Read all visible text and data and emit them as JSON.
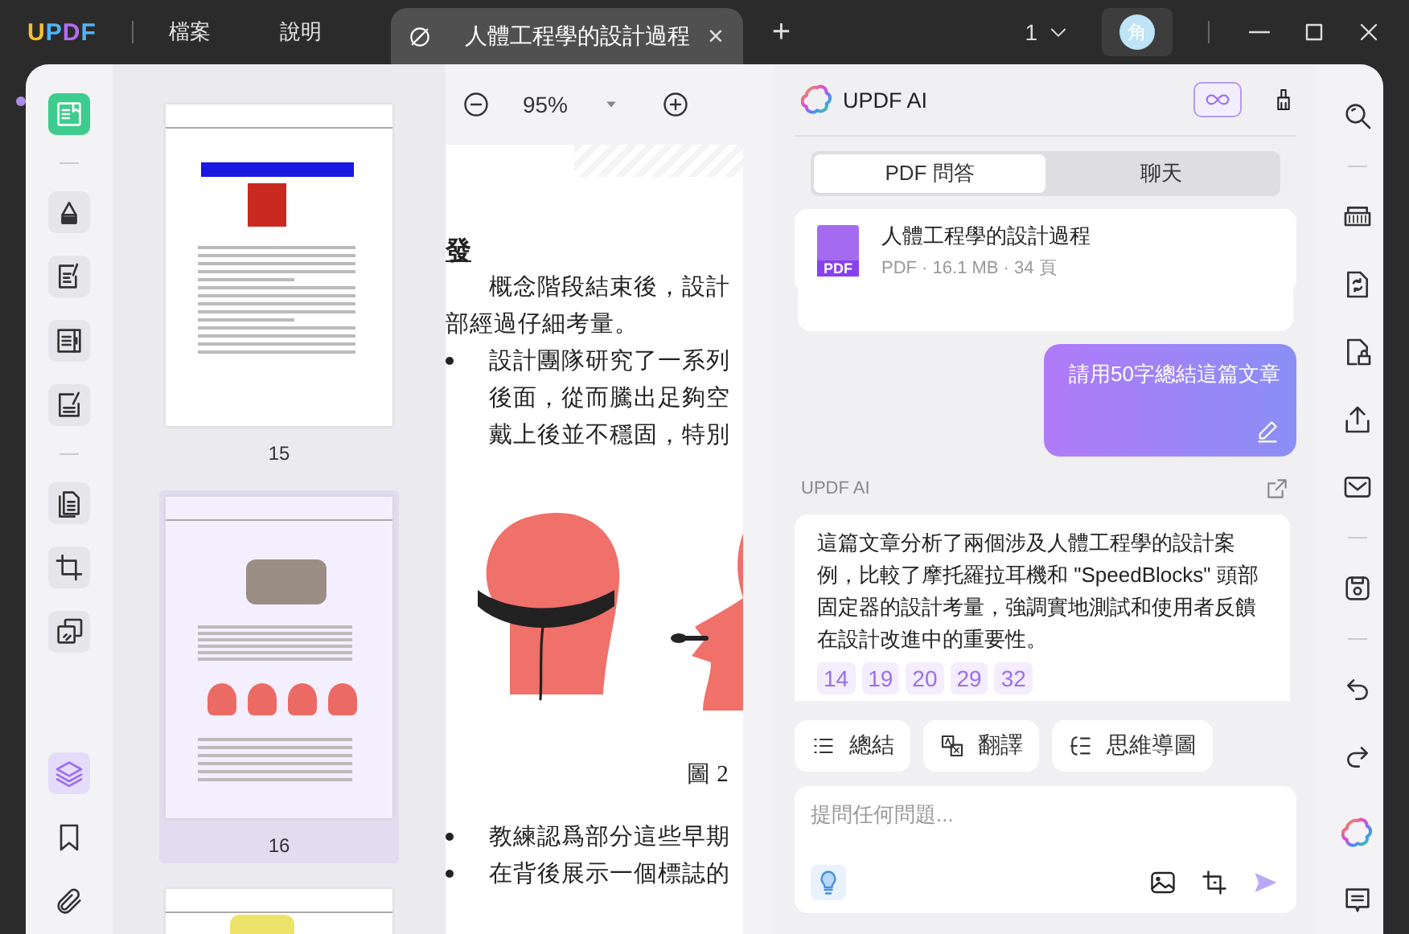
{
  "app_bar": {
    "logo": "UPDF",
    "menus": [
      "檔案",
      "說明"
    ],
    "document_tab": {
      "title": "人體工程學的設計過程",
      "close": "×",
      "selected": true
    },
    "new_tab": "+",
    "page_indicator": "1",
    "avatar": "角"
  },
  "left_rail": {
    "tools": [
      {
        "kind": "reader",
        "selected": true
      },
      {
        "kind": "separator"
      },
      {
        "kind": "highlighter",
        "selected": false
      },
      {
        "kind": "edit",
        "selected": false
      },
      {
        "kind": "columns",
        "selected": false
      },
      {
        "kind": "sign",
        "selected": false
      },
      {
        "kind": "separator"
      },
      {
        "kind": "pages",
        "selected": false
      },
      {
        "kind": "crop",
        "selected": false
      },
      {
        "kind": "stack",
        "selected": false
      },
      {
        "kind": "layers",
        "selected": true
      },
      {
        "kind": "bookmark",
        "selected": false
      },
      {
        "kind": "attachment",
        "selected": false
      }
    ]
  },
  "thumbnails": [
    {
      "page": "15",
      "selected": false
    },
    {
      "page": "16",
      "selected": true
    },
    {
      "selected": false
    }
  ],
  "zoom": {
    "value": "95%"
  },
  "document": {
    "heading": "發",
    "lines": [
      {
        "kind": "indent",
        "text": "概念階段結束後，設計"
      },
      {
        "kind": "plain",
        "text": "部經過仔細考量。"
      },
      {
        "kind": "bullet",
        "text": "設計團隊研究了一系列"
      },
      {
        "kind": "indent",
        "text": "後面，從而騰出足夠空"
      },
      {
        "kind": "indent",
        "text": "戴上後並不穩固，特別"
      }
    ],
    "caption": "圖 2",
    "lines_after": [
      {
        "kind": "bullet",
        "text": "教練認爲部分這些早期"
      },
      {
        "kind": "bullet",
        "text": "在背後展示一個標誌的"
      }
    ]
  },
  "ai_panel": {
    "title": "UPDF AI",
    "tabs": [
      {
        "label": "PDF 問答",
        "selected": true
      },
      {
        "label": "聊天",
        "selected": false
      }
    ],
    "file": {
      "name": "人體工程學的設計過程",
      "meta": "PDF · 16.1 MB · 34 頁",
      "badge": "PDF"
    },
    "user_message": "請用50字總結這篇文章",
    "assistant_label": "UPDF AI",
    "answer": "這篇文章分析了兩個涉及人體工程學的設計案例，比較了摩托羅拉耳機和 \"SpeedBlocks\" 頭部固定器的設計考量，強調實地測試和使用者反饋在設計改進中的重要性。",
    "page_refs": [
      "14",
      "19",
      "20",
      "29",
      "32"
    ],
    "actions": [
      {
        "kind": "summary",
        "label": "總結"
      },
      {
        "kind": "translate",
        "label": "翻譯"
      },
      {
        "kind": "mindmap",
        "label": "思維導圖"
      }
    ],
    "input": {
      "placeholder": "提問任何問題..."
    }
  },
  "right_rail": {
    "tools": [
      {
        "kind": "search"
      },
      {
        "kind": "separator"
      },
      {
        "kind": "ocr"
      },
      {
        "kind": "convert"
      },
      {
        "kind": "protect"
      },
      {
        "kind": "share"
      },
      {
        "kind": "mail"
      },
      {
        "kind": "separator"
      },
      {
        "kind": "save"
      },
      {
        "kind": "separator"
      },
      {
        "kind": "undo"
      },
      {
        "kind": "redo"
      },
      {
        "kind": "ai"
      },
      {
        "kind": "comment"
      }
    ]
  }
}
